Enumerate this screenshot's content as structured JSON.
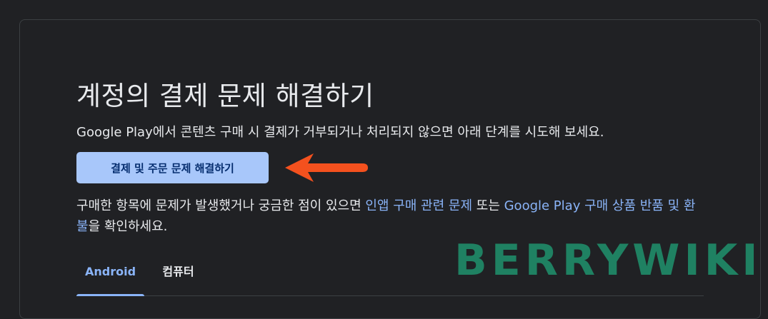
{
  "page": {
    "title": "계정의 결제 문제 해결하기",
    "intro": "Google Play에서 콘텐츠 구매 시 결제가 거부되거나 처리되지 않으면 아래 단계를 시도해 보세요.",
    "primary_button": "결제 및 주문 문제 해결하기",
    "body": {
      "text_before": "구매한 항목에 문제가 발생했거나 궁금한 점이 있으면 ",
      "link_1": "인앱 구매 관련 문제",
      "text_middle": " 또는 ",
      "link_2": "Google Play 구매 상품 반품 및 환불",
      "text_after": "을 확인하세요."
    },
    "tabs": [
      {
        "label": "Android",
        "active": true
      },
      {
        "label": "컴퓨터",
        "active": false
      }
    ]
  },
  "watermark": "BERRYWIKI",
  "annotation": {
    "arrow_icon": "left-arrow-icon",
    "arrow_color": "#f4511e"
  },
  "colors": {
    "background": "#202124",
    "accent": "#8ab4f8",
    "button_bg": "#a8c7fa",
    "watermark": "#1f8a68"
  }
}
